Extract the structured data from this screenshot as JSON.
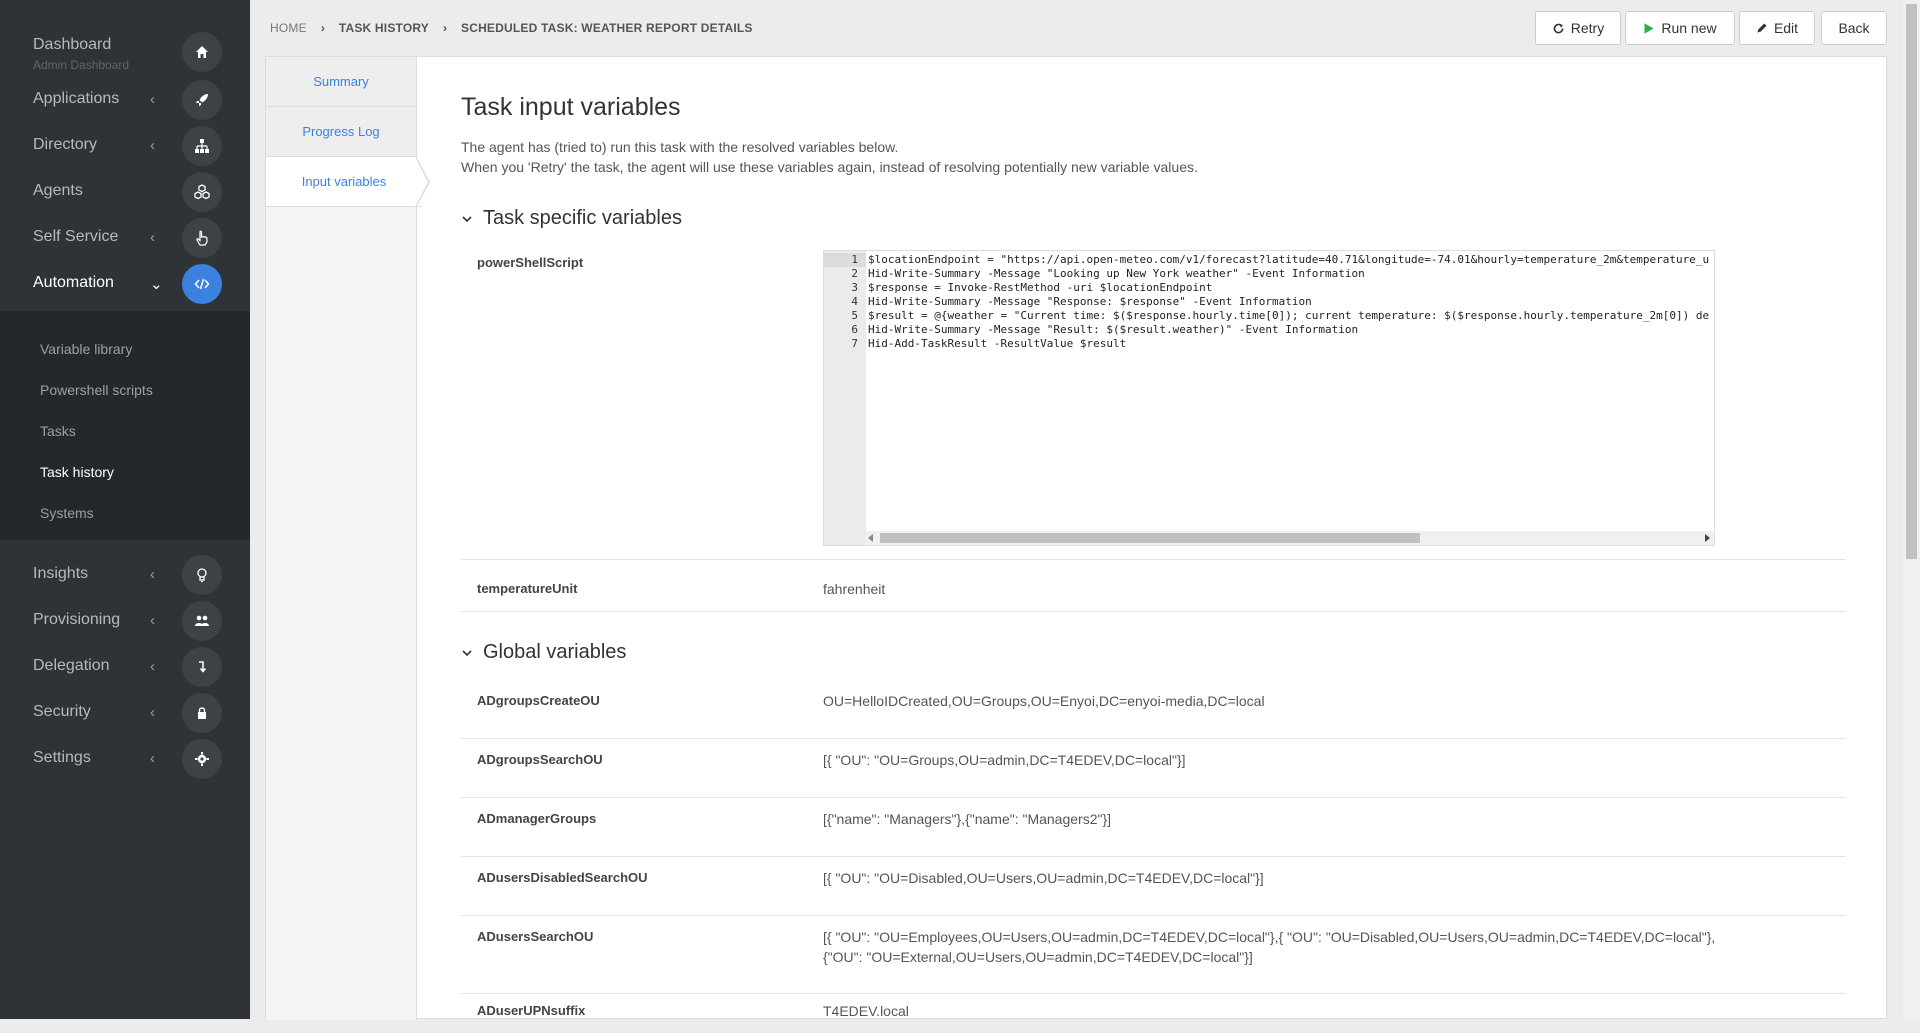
{
  "sidebar": {
    "items": [
      {
        "label": "Dashboard",
        "sub": "Admin Dashboard",
        "icon": "home-icon"
      },
      {
        "label": "Applications",
        "icon": "rocket-icon"
      },
      {
        "label": "Directory",
        "icon": "sitemap-icon"
      },
      {
        "label": "Agents",
        "icon": "cubes-icon"
      },
      {
        "label": "Self Service",
        "icon": "hand-pointer-icon"
      },
      {
        "label": "Automation",
        "icon": "code-icon"
      },
      {
        "label": "Insights",
        "icon": "lightbulb-icon"
      },
      {
        "label": "Provisioning",
        "icon": "users-icon"
      },
      {
        "label": "Delegation",
        "icon": "level-down-icon"
      },
      {
        "label": "Security",
        "icon": "lock-icon"
      },
      {
        "label": "Settings",
        "icon": "gear-icon"
      }
    ],
    "automation_submenu": [
      "Variable library",
      "Powershell scripts",
      "Tasks",
      "Task history",
      "Systems"
    ]
  },
  "breadcrumb": [
    "HOME",
    "TASK HISTORY",
    "SCHEDULED TASK: WEATHER REPORT DETAILS"
  ],
  "toolbar": {
    "retry": "Retry",
    "run_new": "Run new",
    "edit": "Edit",
    "back": "Back"
  },
  "tabs": [
    "Summary",
    "Progress Log",
    "Input variables"
  ],
  "page": {
    "title": "Task input variables",
    "desc_line1": "The agent has (tried to) run this task with the resolved variables below.",
    "desc_line2": "When you 'Retry' the task, the agent will use these variables again, instead of resolving potentially new variable values."
  },
  "task_section": {
    "title": "Task specific variables",
    "script_name": "powerShellScript",
    "code": [
      "$locationEndpoint = \"https://api.open-meteo.com/v1/forecast?latitude=40.71&longitude=-74.01&hourly=temperature_2m&temperature_u",
      "Hid-Write-Summary -Message \"Looking up New York weather\" -Event Information",
      "$response = Invoke-RestMethod -uri $locationEndpoint",
      "Hid-Write-Summary -Message \"Response: $response\" -Event Information",
      "$result = @{weather = \"Current time: $($response.hourly.time[0]); current temperature: $($response.hourly.temperature_2m[0]) de",
      "Hid-Write-Summary -Message \"Result: $($result.weather)\" -Event Information",
      "Hid-Add-TaskResult -ResultValue $result"
    ],
    "line_numbers": [
      "1",
      "2",
      "3",
      "4",
      "5",
      "6",
      "7"
    ],
    "temperature_name": "temperatureUnit",
    "temperature_value": "fahrenheit"
  },
  "global_section": {
    "title": "Global variables",
    "vars": [
      {
        "name": "ADgroupsCreateOU",
        "value": "OU=HelloIDCreated,OU=Groups,OU=Enyoi,DC=enyoi-media,DC=local"
      },
      {
        "name": "ADgroupsSearchOU",
        "value": "[{ \"OU\": \"OU=Groups,OU=admin,DC=T4EDEV,DC=local\"}]"
      },
      {
        "name": "ADmanagerGroups",
        "value": "[{\"name\": \"Managers\"},{\"name\": \"Managers2\"}]"
      },
      {
        "name": "ADusersDisabledSearchOU",
        "value": "[{ \"OU\": \"OU=Disabled,OU=Users,OU=admin,DC=T4EDEV,DC=local\"}]"
      },
      {
        "name": "ADusersSearchOU",
        "value": "[{ \"OU\": \"OU=Employees,OU=Users,OU=admin,DC=T4EDEV,DC=local\"},{ \"OU\": \"OU=Disabled,OU=Users,OU=admin,DC=T4EDEV,DC=local\"},",
        "value2": "{\"OU\": \"OU=External,OU=Users,OU=admin,DC=T4EDEV,DC=local\"}]"
      },
      {
        "name": "ADuserUPNsuffix",
        "value": "T4EDEV.local"
      }
    ]
  },
  "colors": {
    "accent": "#3b82e0",
    "sidebar": "#2f3338",
    "run_icon": "#2bb24c"
  }
}
